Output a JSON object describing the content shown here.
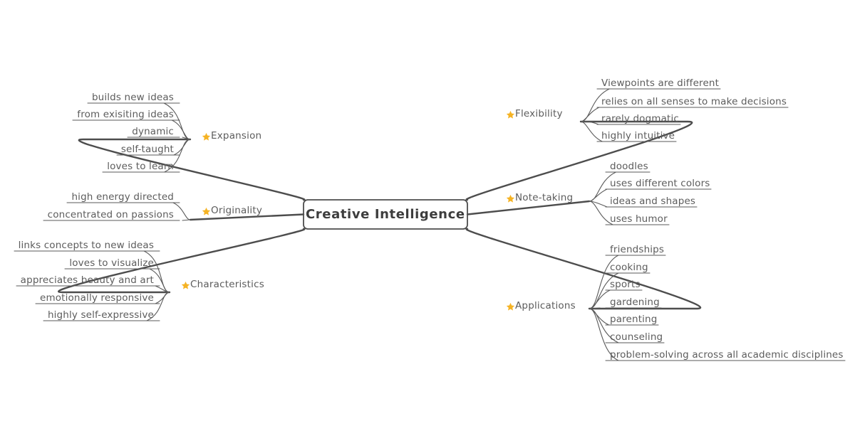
{
  "diagram": {
    "type": "mind-map",
    "title": "Creative Intelligence",
    "background_color": "#ffffff",
    "line_color": "#4d4d4d",
    "text_color": "#5c5c5c",
    "accent_color": "#f5b324",
    "bullet_icon": "star-icon"
  },
  "central": {
    "label": "Creative Intelligence"
  },
  "branches": [
    {
      "id": "expansion",
      "label": "Expansion",
      "side": "left",
      "icon": "star-icon",
      "children": [
        {
          "label": "builds new ideas"
        },
        {
          "label": "from exisiting ideas"
        },
        {
          "label": "dynamic"
        },
        {
          "label": "self-taught"
        },
        {
          "label": "loves to learn"
        }
      ]
    },
    {
      "id": "originality",
      "label": "Originality",
      "side": "left",
      "icon": "star-icon",
      "children": [
        {
          "label": "high energy directed"
        },
        {
          "label": "concentrated on passions"
        }
      ]
    },
    {
      "id": "characteristics",
      "label": "Characteristics",
      "side": "left",
      "icon": "star-icon",
      "children": [
        {
          "label": "links concepts to new ideas"
        },
        {
          "label": "loves to visualize"
        },
        {
          "label": "appreciates beauty and art"
        },
        {
          "label": "emotionally responsive"
        },
        {
          "label": "highly self-expressive"
        }
      ]
    },
    {
      "id": "flexibility",
      "label": "Flexibility",
      "side": "right",
      "icon": "star-icon",
      "children": [
        {
          "label": "Viewpoints are different"
        },
        {
          "label": "relies on all senses to make decisions"
        },
        {
          "label": "rarely dogmatic"
        },
        {
          "label": "highly intuitive"
        }
      ]
    },
    {
      "id": "note-taking",
      "label": "Note-taking",
      "side": "right",
      "icon": "star-icon",
      "children": [
        {
          "label": "doodles"
        },
        {
          "label": "uses different colors"
        },
        {
          "label": "ideas and shapes"
        },
        {
          "label": "uses humor"
        }
      ]
    },
    {
      "id": "applications",
      "label": "Applications",
      "side": "right",
      "icon": "star-icon",
      "children": [
        {
          "label": "friendships"
        },
        {
          "label": "cooking"
        },
        {
          "label": "sports"
        },
        {
          "label": "gardening"
        },
        {
          "label": "parenting"
        },
        {
          "label": "counseling"
        },
        {
          "label": "problem-solving across all academic disciplines"
        }
      ]
    }
  ]
}
